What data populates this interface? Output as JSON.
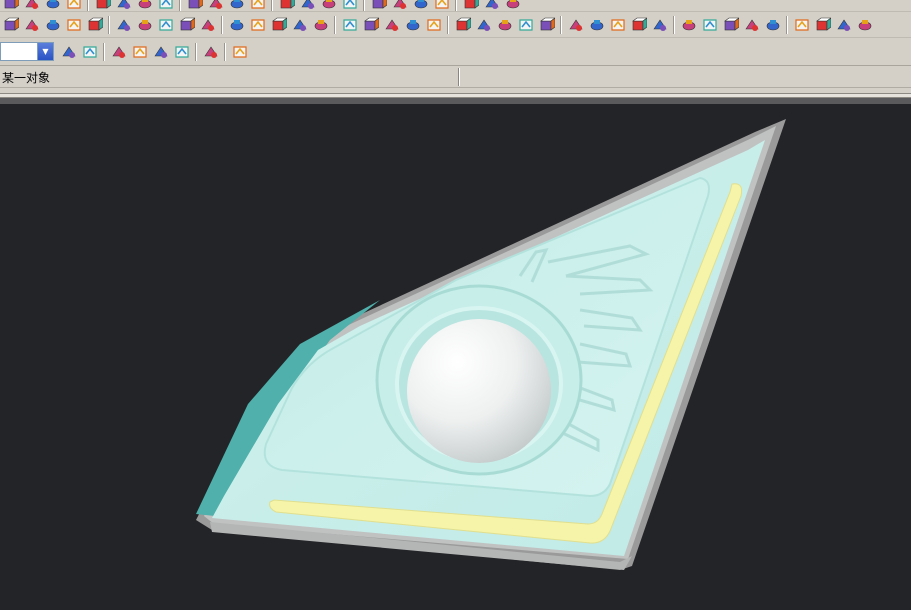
{
  "window": {
    "title": ""
  },
  "toolbar": {
    "row1_icons": [
      "point-constructor-icon",
      "save-icon",
      "sheet-icon",
      "sphere-icon",
      "block-icon",
      "cylinder-icon",
      "cone-icon",
      "extrude-icon",
      "revolve-icon",
      "blend-icon",
      "chamfer-icon",
      "shell-icon",
      "draft-icon",
      "trim-icon",
      "sew-icon",
      "pattern-icon",
      "mirror-icon",
      "sketch-icon",
      "line-icon",
      "arc-icon",
      "measure-icon",
      "analysis-icon",
      "section-icon"
    ],
    "row2_icons": [
      "transform-icon",
      "snap-icon",
      "layer-icon",
      "paint-icon",
      "scale-icon",
      "ruler-icon",
      "move-icon",
      "copy-icon",
      "delete-icon",
      "wcs-icon",
      "datum-plane-icon",
      "datum-axis-icon",
      "surface-icon",
      "through-curves-icon",
      "offset-icon",
      "edge-blend-icon",
      "face-blend-icon",
      "sweep-icon",
      "thicken-icon",
      "split-icon",
      "unite-icon",
      "subtract-icon",
      "intersect-icon",
      "extract-icon",
      "bounded-plane-icon",
      "n-sided-icon",
      "studio-icon",
      "law-icon",
      "swept-icon",
      "variational-icon",
      "wrap-icon",
      "section-surface-icon",
      "bridge-icon",
      "fillet-icon",
      "smooth-icon",
      "box-icon",
      "box-open-icon",
      "box-shaded-icon",
      "box-wire-icon"
    ],
    "row3": {
      "combo_value": "",
      "icons": [
        "filter-icon",
        "select-point-icon",
        "undo-icon",
        "eraser-icon",
        "snap-grid-icon",
        "path-icon",
        "marquee-select-icon",
        "shaded-cube-icon"
      ]
    }
  },
  "status": {
    "text": "某一对象",
    "right_text": ""
  },
  "colors": {
    "background": "#232427",
    "toolbar": "#d4d0c8",
    "part_face": "#ccf0ec",
    "part_edge": "#a8a8a8",
    "stripe": "#f5f4a8",
    "sphere": "#f2f4f4"
  }
}
